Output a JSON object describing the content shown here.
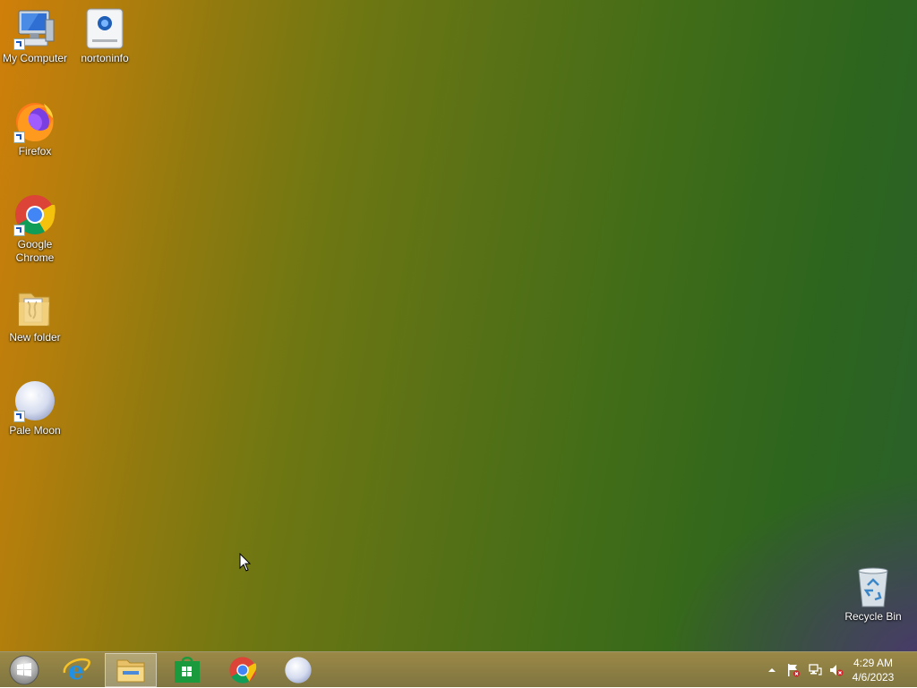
{
  "desktop": {
    "icons": [
      {
        "label": "My Computer",
        "icon": "computer-icon"
      },
      {
        "label": "nortoninfo",
        "icon": "drive-icon"
      },
      {
        "label": "Firefox",
        "icon": "firefox-icon"
      },
      {
        "label": "Google Chrome",
        "icon": "chrome-icon"
      },
      {
        "label": "New folder",
        "icon": "folder-icon"
      },
      {
        "label": "Pale Moon",
        "icon": "pale-moon-icon"
      },
      {
        "label": "Recycle Bin",
        "icon": "recycle-bin-icon"
      }
    ]
  },
  "taskbar": {
    "buttons": [
      {
        "icon": "start-icon"
      },
      {
        "icon": "internet-explorer-icon"
      },
      {
        "icon": "file-explorer-icon"
      },
      {
        "icon": "store-icon"
      },
      {
        "icon": "chrome-icon"
      },
      {
        "icon": "pale-moon-icon"
      }
    ],
    "tray": {
      "icons": [
        "show-hidden-icons-icon",
        "action-center-flag-icon",
        "network-icon",
        "volume-muted-icon"
      ],
      "time": "4:29 AM",
      "date": "4/6/2023"
    }
  },
  "colors": {
    "wallpaper_left": "#d07f0a",
    "wallpaper_right": "#2a5f2a",
    "taskbar": "#8c7a3c"
  }
}
